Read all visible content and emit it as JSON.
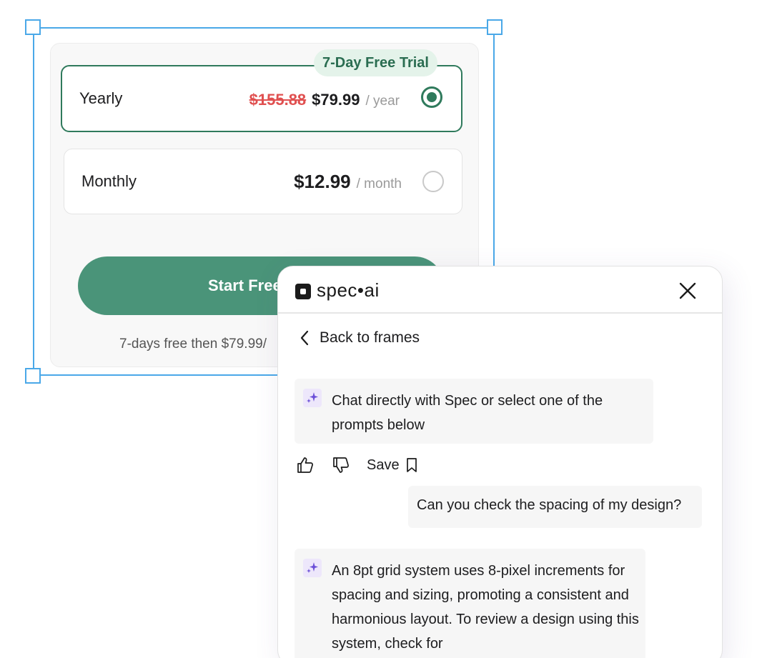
{
  "pricing": {
    "trial_badge": "7-Day Free Trial",
    "yearly": {
      "name": "Yearly",
      "old_price": "$155.88",
      "price": "$79.99",
      "period": "/ year",
      "selected": true
    },
    "monthly": {
      "name": "Monthly",
      "price": "$12.99",
      "period": "/ month",
      "selected": false
    },
    "cta_label": "Start Free",
    "fine_print": "7-days free then $79.99/"
  },
  "panel": {
    "brand": "spec•ai",
    "back_label": "Back to frames",
    "messages": [
      {
        "role": "assistant",
        "text": "Chat directly with Spec or select one of the prompts below"
      },
      {
        "role": "user",
        "text": "Can you check the spacing of my design?"
      },
      {
        "role": "assistant",
        "text": "An 8pt grid system uses 8-pixel increments for spacing and sizing, promoting a consistent and harmonious layout. To review a design using this system, check for"
      }
    ],
    "save_label": "Save"
  },
  "colors": {
    "accent_green": "#2f7a5c",
    "cta_green": "#4a9479",
    "strike_red": "#e05050",
    "selection_blue": "#4aa8e8",
    "sparkle_purple": "#6b4fd8"
  }
}
